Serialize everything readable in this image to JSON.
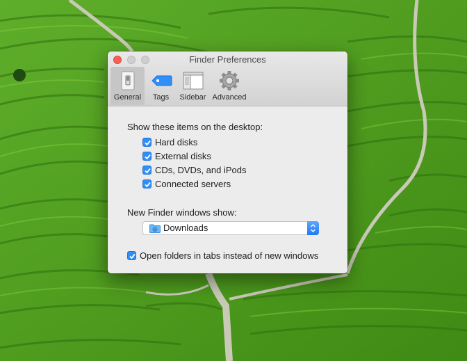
{
  "window": {
    "title": "Finder Preferences"
  },
  "toolbar": {
    "tabs": [
      {
        "label": "General",
        "icon": "general-switch-icon",
        "selected": true
      },
      {
        "label": "Tags",
        "icon": "tag-icon",
        "selected": false
      },
      {
        "label": "Sidebar",
        "icon": "sidebar-icon",
        "selected": false
      },
      {
        "label": "Advanced",
        "icon": "gear-icon",
        "selected": false
      }
    ]
  },
  "general": {
    "desktop_heading": "Show these items on the desktop:",
    "desktop_items": [
      {
        "label": "Hard disks",
        "checked": true
      },
      {
        "label": "External disks",
        "checked": true
      },
      {
        "label": "CDs, DVDs, and iPods",
        "checked": true
      },
      {
        "label": "Connected servers",
        "checked": true
      }
    ],
    "new_window_heading": "New Finder windows show:",
    "new_window_value": "Downloads",
    "new_window_icon": "downloads-folder-icon",
    "tabs_option": {
      "label": "Open folders in tabs instead of new windows",
      "checked": true
    }
  },
  "colors": {
    "accent": "#2f8ff7",
    "close": "#fc5f57"
  }
}
